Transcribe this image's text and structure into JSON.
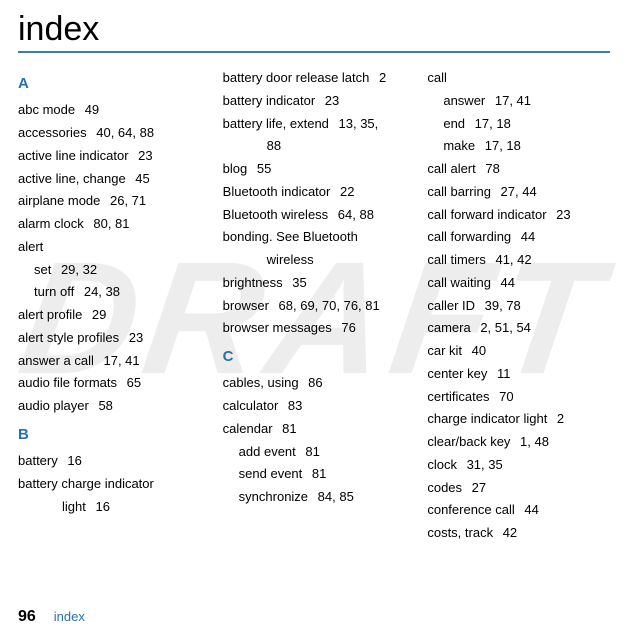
{
  "title": "index",
  "watermark": "DRAFT",
  "footer": {
    "page": "96",
    "section": "index"
  },
  "columns": [
    [
      {
        "type": "letter",
        "label": "A"
      },
      {
        "type": "entry",
        "term": "abc mode",
        "pages": "49"
      },
      {
        "type": "entry",
        "term": "accessories",
        "pages": "40, 64, 88"
      },
      {
        "type": "entry",
        "term": "active line indicator",
        "pages": "23"
      },
      {
        "type": "entry",
        "term": "active line, change",
        "pages": "45"
      },
      {
        "type": "entry",
        "term": "airplane mode",
        "pages": "26, 71"
      },
      {
        "type": "entry",
        "term": "alarm clock",
        "pages": "80, 81"
      },
      {
        "type": "entry",
        "term": "alert",
        "pages": ""
      },
      {
        "type": "sub1",
        "term": "set",
        "pages": "29, 32"
      },
      {
        "type": "sub1",
        "term": "turn off",
        "pages": "24, 38"
      },
      {
        "type": "entry",
        "term": "alert profile",
        "pages": "29"
      },
      {
        "type": "entry",
        "term": "alert style profiles",
        "pages": "23"
      },
      {
        "type": "entry",
        "term": "answer a call",
        "pages": "17, 41"
      },
      {
        "type": "entry",
        "term": "audio file formats",
        "pages": "65"
      },
      {
        "type": "entry",
        "term": "audio player",
        "pages": "58"
      },
      {
        "type": "letter",
        "label": "B"
      },
      {
        "type": "entry",
        "term": "battery",
        "pages": "16"
      },
      {
        "type": "entry",
        "term": "battery charge indicator",
        "pages": ""
      },
      {
        "type": "sub2",
        "term": "light",
        "pages": "16"
      }
    ],
    [
      {
        "type": "entry",
        "term": "battery door release latch",
        "pages": "2"
      },
      {
        "type": "entry",
        "term": "battery indicator",
        "pages": "23"
      },
      {
        "type": "entry",
        "term": "battery life, extend",
        "pages": "13, 35,"
      },
      {
        "type": "sub2",
        "term": "88",
        "pages": ""
      },
      {
        "type": "entry",
        "term": "blog",
        "pages": "55"
      },
      {
        "type": "entry",
        "term": "Bluetooth indicator",
        "pages": "22"
      },
      {
        "type": "entry",
        "term": "Bluetooth wireless",
        "pages": "64, 88"
      },
      {
        "type": "entry",
        "term": "bonding. See Bluetooth",
        "pages": ""
      },
      {
        "type": "sub2",
        "term": "wireless",
        "pages": ""
      },
      {
        "type": "entry",
        "term": "brightness",
        "pages": "35"
      },
      {
        "type": "entry",
        "term": "browser",
        "pages": "68, 69, 70, 76, 81"
      },
      {
        "type": "entry",
        "term": "browser messages",
        "pages": "76"
      },
      {
        "type": "letter",
        "label": "C"
      },
      {
        "type": "entry",
        "term": "cables, using",
        "pages": "86"
      },
      {
        "type": "entry",
        "term": "calculator",
        "pages": "83"
      },
      {
        "type": "entry",
        "term": "calendar",
        "pages": "81"
      },
      {
        "type": "sub1",
        "term": "add event",
        "pages": "81"
      },
      {
        "type": "sub1",
        "term": "send event",
        "pages": "81"
      },
      {
        "type": "sub1",
        "term": "synchronize",
        "pages": "84, 85"
      }
    ],
    [
      {
        "type": "entry",
        "term": "call",
        "pages": ""
      },
      {
        "type": "sub1",
        "term": "answer",
        "pages": "17, 41"
      },
      {
        "type": "sub1",
        "term": "end",
        "pages": "17, 18"
      },
      {
        "type": "sub1",
        "term": "make",
        "pages": "17, 18"
      },
      {
        "type": "entry",
        "term": "call alert",
        "pages": "78"
      },
      {
        "type": "entry",
        "term": "call barring",
        "pages": "27, 44"
      },
      {
        "type": "entry",
        "term": "call forward indicator",
        "pages": "23"
      },
      {
        "type": "entry",
        "term": "call forwarding",
        "pages": "44"
      },
      {
        "type": "entry",
        "term": "call timers",
        "pages": "41, 42"
      },
      {
        "type": "entry",
        "term": "call waiting",
        "pages": "44"
      },
      {
        "type": "entry",
        "term": "caller ID",
        "pages": "39, 78"
      },
      {
        "type": "entry",
        "term": "camera",
        "pages": "2, 51, 54"
      },
      {
        "type": "entry",
        "term": "car kit",
        "pages": "40"
      },
      {
        "type": "entry",
        "term": "center key",
        "pages": "11"
      },
      {
        "type": "entry",
        "term": "certificates",
        "pages": "70"
      },
      {
        "type": "entry",
        "term": "charge indicator light",
        "pages": "2"
      },
      {
        "type": "entry",
        "term": "clear/back key",
        "pages": "1, 48"
      },
      {
        "type": "entry",
        "term": "clock",
        "pages": "31, 35"
      },
      {
        "type": "entry",
        "term": "codes",
        "pages": "27"
      },
      {
        "type": "entry",
        "term": "conference call",
        "pages": "44"
      },
      {
        "type": "entry",
        "term": "costs, track",
        "pages": "42"
      }
    ]
  ]
}
